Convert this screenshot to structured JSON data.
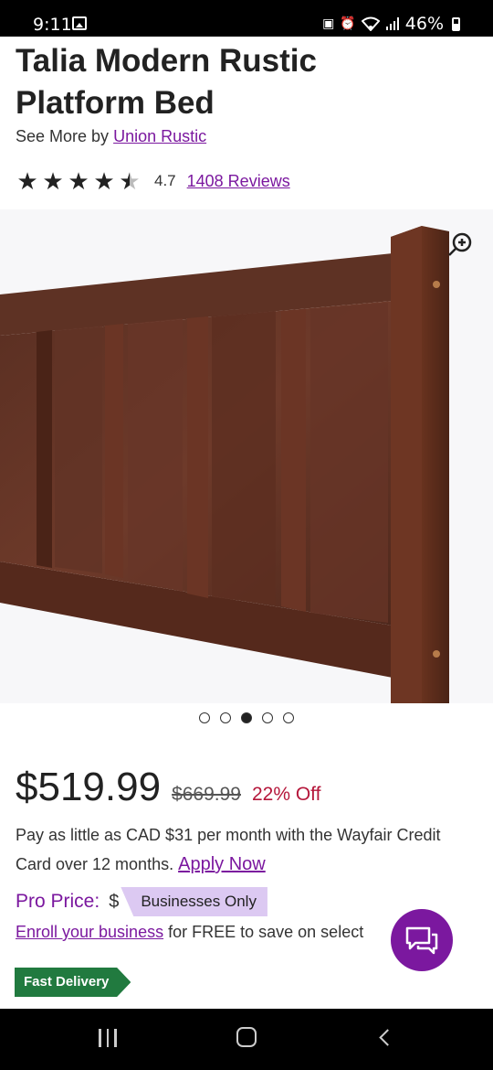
{
  "status_bar": {
    "time": "9:11",
    "battery": "46%"
  },
  "product": {
    "title": "Talia Modern Rustic Platform Bed",
    "see_more_prefix": "See More by",
    "brand": "Union Rustic",
    "rating": "4.7",
    "rating_value": 4.5,
    "reviews": "1408 Reviews"
  },
  "gallery": {
    "total_images": 5,
    "active_index": 2
  },
  "pricing": {
    "price": "$519.99",
    "was_price": "$669.99",
    "discount": "22% Off",
    "finance_text": "Pay as little as CAD $31 per month with the Wayfair Credit Card over 12 months.",
    "apply_now": "Apply Now",
    "pro_price_label": "Pro Price:",
    "pro_dollar": "$",
    "businesses_only": "Businesses Only",
    "enroll_link": "Enroll your business",
    "enroll_suffix": "for FREE to save on select"
  },
  "badges": {
    "fast_delivery": "Fast Delivery"
  },
  "colors": {
    "brand_purple": "#7b189f",
    "discount_red": "#b5173b",
    "delivery_green": "#217a3f",
    "badge_lavender": "#dcc9f2"
  }
}
